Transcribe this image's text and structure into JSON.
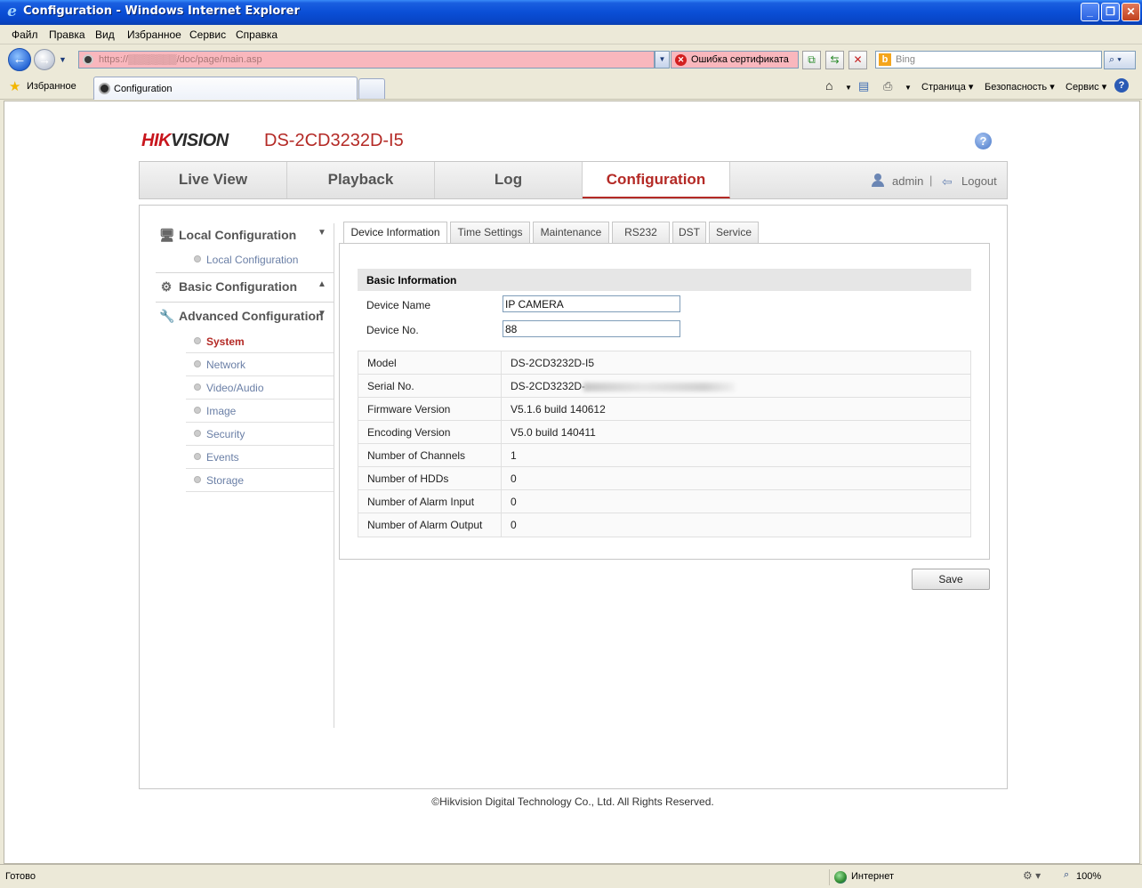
{
  "window": {
    "title": "Configuration - Windows Internet Explorer",
    "minimize": "_",
    "maximize": "❐",
    "close": "✕"
  },
  "menubar": [
    "Файл",
    "Правка",
    "Вид",
    "Избранное",
    "Сервис",
    "Справка"
  ],
  "address": {
    "url": "https://▒▒▒▒▒▒▒/doc/page/main.asp",
    "cert_error": "Ошибка сертификата",
    "search_placeholder": "Bing"
  },
  "favbar": {
    "favorites_label": "Избранное",
    "tab_title": "Configuration",
    "commands": [
      "Страница ▾",
      "Безопасность ▾",
      "Сервис ▾"
    ]
  },
  "page": {
    "brand": "HIKVISION",
    "model": "DS-2CD3232D-I5",
    "help_icon": "?",
    "nav_tabs": [
      "Live View",
      "Playback",
      "Log",
      "Configuration"
    ],
    "active_nav": "Configuration",
    "user": "admin",
    "separator": "|",
    "logout": "Logout"
  },
  "sidebar": {
    "local_config": {
      "label": "Local Configuration",
      "items": [
        "Local Configuration"
      ]
    },
    "basic_config": {
      "label": "Basic Configuration"
    },
    "advanced_config": {
      "label": "Advanced Configuration",
      "items": [
        "System",
        "Network",
        "Video/Audio",
        "Image",
        "Security",
        "Events",
        "Storage"
      ],
      "active": "System"
    }
  },
  "subtabs": [
    "Device Information",
    "Time Settings",
    "Maintenance",
    "RS232",
    "DST",
    "Service"
  ],
  "active_subtab": "Device Information",
  "basic_info": {
    "heading": "Basic Information",
    "device_name_label": "Device Name",
    "device_name_value": "IP CAMERA",
    "device_no_label": "Device No.",
    "device_no_value": "88"
  },
  "info_rows": [
    {
      "label": "Model",
      "value": "DS-2CD3232D-I5"
    },
    {
      "label": "Serial No.",
      "value": "DS-2CD3232D-"
    },
    {
      "label": "Firmware Version",
      "value": "V5.1.6 build 140612"
    },
    {
      "label": "Encoding Version",
      "value": "V5.0 build 140411"
    },
    {
      "label": "Number of Channels",
      "value": "1"
    },
    {
      "label": "Number of HDDs",
      "value": "0"
    },
    {
      "label": "Number of Alarm Input",
      "value": "0"
    },
    {
      "label": "Number of Alarm Output",
      "value": "0"
    }
  ],
  "save_label": "Save",
  "footer": "©Hikvision Digital Technology Co., Ltd. All Rights Reserved.",
  "statusbar": {
    "ready": "Готово",
    "zone": "Интернет",
    "zoom": "100%"
  },
  "colors": {
    "accent": "#b42a26",
    "brand_red": "#c8161d",
    "link": "#6a7fa6",
    "cert_bg": "#f9b7bd"
  }
}
